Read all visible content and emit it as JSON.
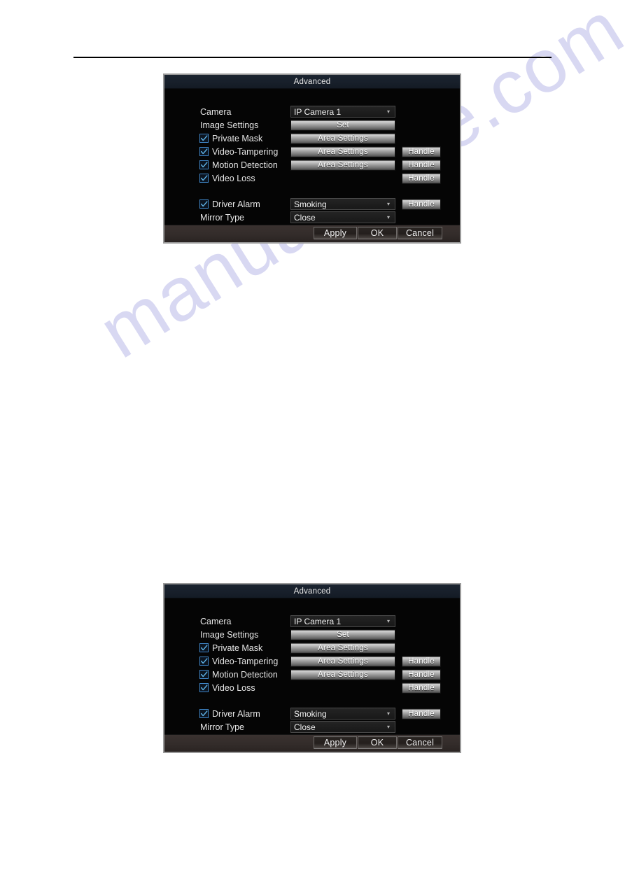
{
  "page": {
    "watermark": "manualshive.com"
  },
  "dialog": {
    "title": "Advanced",
    "rows": {
      "camera": {
        "label": "Camera",
        "value": "IP Camera 1",
        "chevron": "chevron-down-icon"
      },
      "image_settings": {
        "label": "Image Settings",
        "button": "Set"
      },
      "private_mask": {
        "label": "Private Mask",
        "checked": true,
        "button": "Area Settings"
      },
      "video_tampering": {
        "label": "Video-Tampering",
        "checked": true,
        "button": "Area Settings",
        "handle": "Handle"
      },
      "motion_detection": {
        "label": "Motion Detection",
        "checked": true,
        "button": "Area Settings",
        "handle": "Handle"
      },
      "video_loss": {
        "label": "Video Loss",
        "checked": true,
        "handle": "Handle"
      },
      "driver_alarm": {
        "label": "Driver Alarm",
        "checked": true,
        "value": "Smoking",
        "handle": "Handle",
        "chevron": "chevron-down-icon"
      },
      "mirror_type": {
        "label": "Mirror Type",
        "value": "Close",
        "chevron": "chevron-down-icon"
      }
    },
    "footer": {
      "apply": "Apply",
      "ok": "OK",
      "cancel": "Cancel"
    }
  },
  "colors": {
    "titlebar": "#18202b",
    "body": "#050505",
    "footer": "#332c2a",
    "checkbox_border": "#3f86c8",
    "checkbox_tick": "#5fb4e8",
    "border": "#9a9a9a",
    "watermark": "#d8d8f2"
  }
}
